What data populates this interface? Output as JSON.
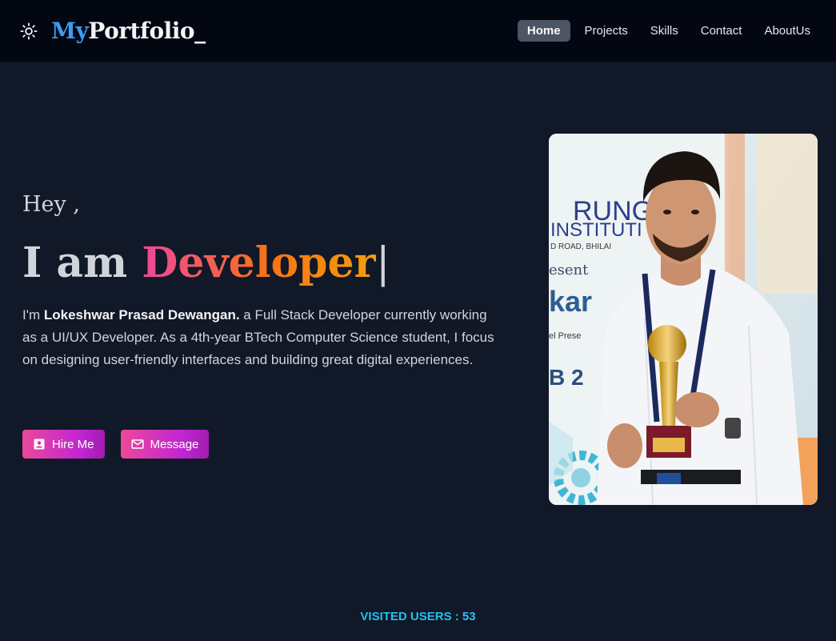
{
  "nav": {
    "brand_prefix": "My",
    "brand_rest": "Portfolio_",
    "theme_icon": "sun-icon",
    "links": [
      {
        "label": "Home",
        "active": true
      },
      {
        "label": "Projects",
        "active": false
      },
      {
        "label": "Skills",
        "active": false
      },
      {
        "label": "Contact",
        "active": false
      },
      {
        "label": "AboutUs",
        "active": false
      }
    ]
  },
  "hero": {
    "greeting": "Hey ,",
    "headline_prefix": "I am",
    "headline_role": "Developer",
    "cursor": "|",
    "intro_prefix": "I'm ",
    "intro_name": "Lokeshwar Prasad Dewangan.",
    "intro_rest": " a Full Stack Developer currently working as a UI/UX Developer. As a 4th-year BTech Computer Science student, I focus on designing user-friendly interfaces and building great digital experiences.",
    "hire_label": "Hire Me",
    "hire_icon": "contact-card-icon",
    "message_label": "Message",
    "message_icon": "mail-icon"
  },
  "photo": {
    "backdrop_texts": [
      "RUNG",
      "INSTITUTI",
      "D ROAD, BHILAI",
      "esent",
      "kar",
      "el Prese",
      "B 2"
    ]
  },
  "footer": {
    "visited_label": "VISITED USERS :",
    "visited_count": "53"
  },
  "colors": {
    "background": "#111827",
    "navbar": "#030712",
    "brand_accent": "#3b9cf0",
    "gradient_start": "#ec4899",
    "gradient_end": "#a21caf",
    "visited_text": "#22c0f0"
  }
}
